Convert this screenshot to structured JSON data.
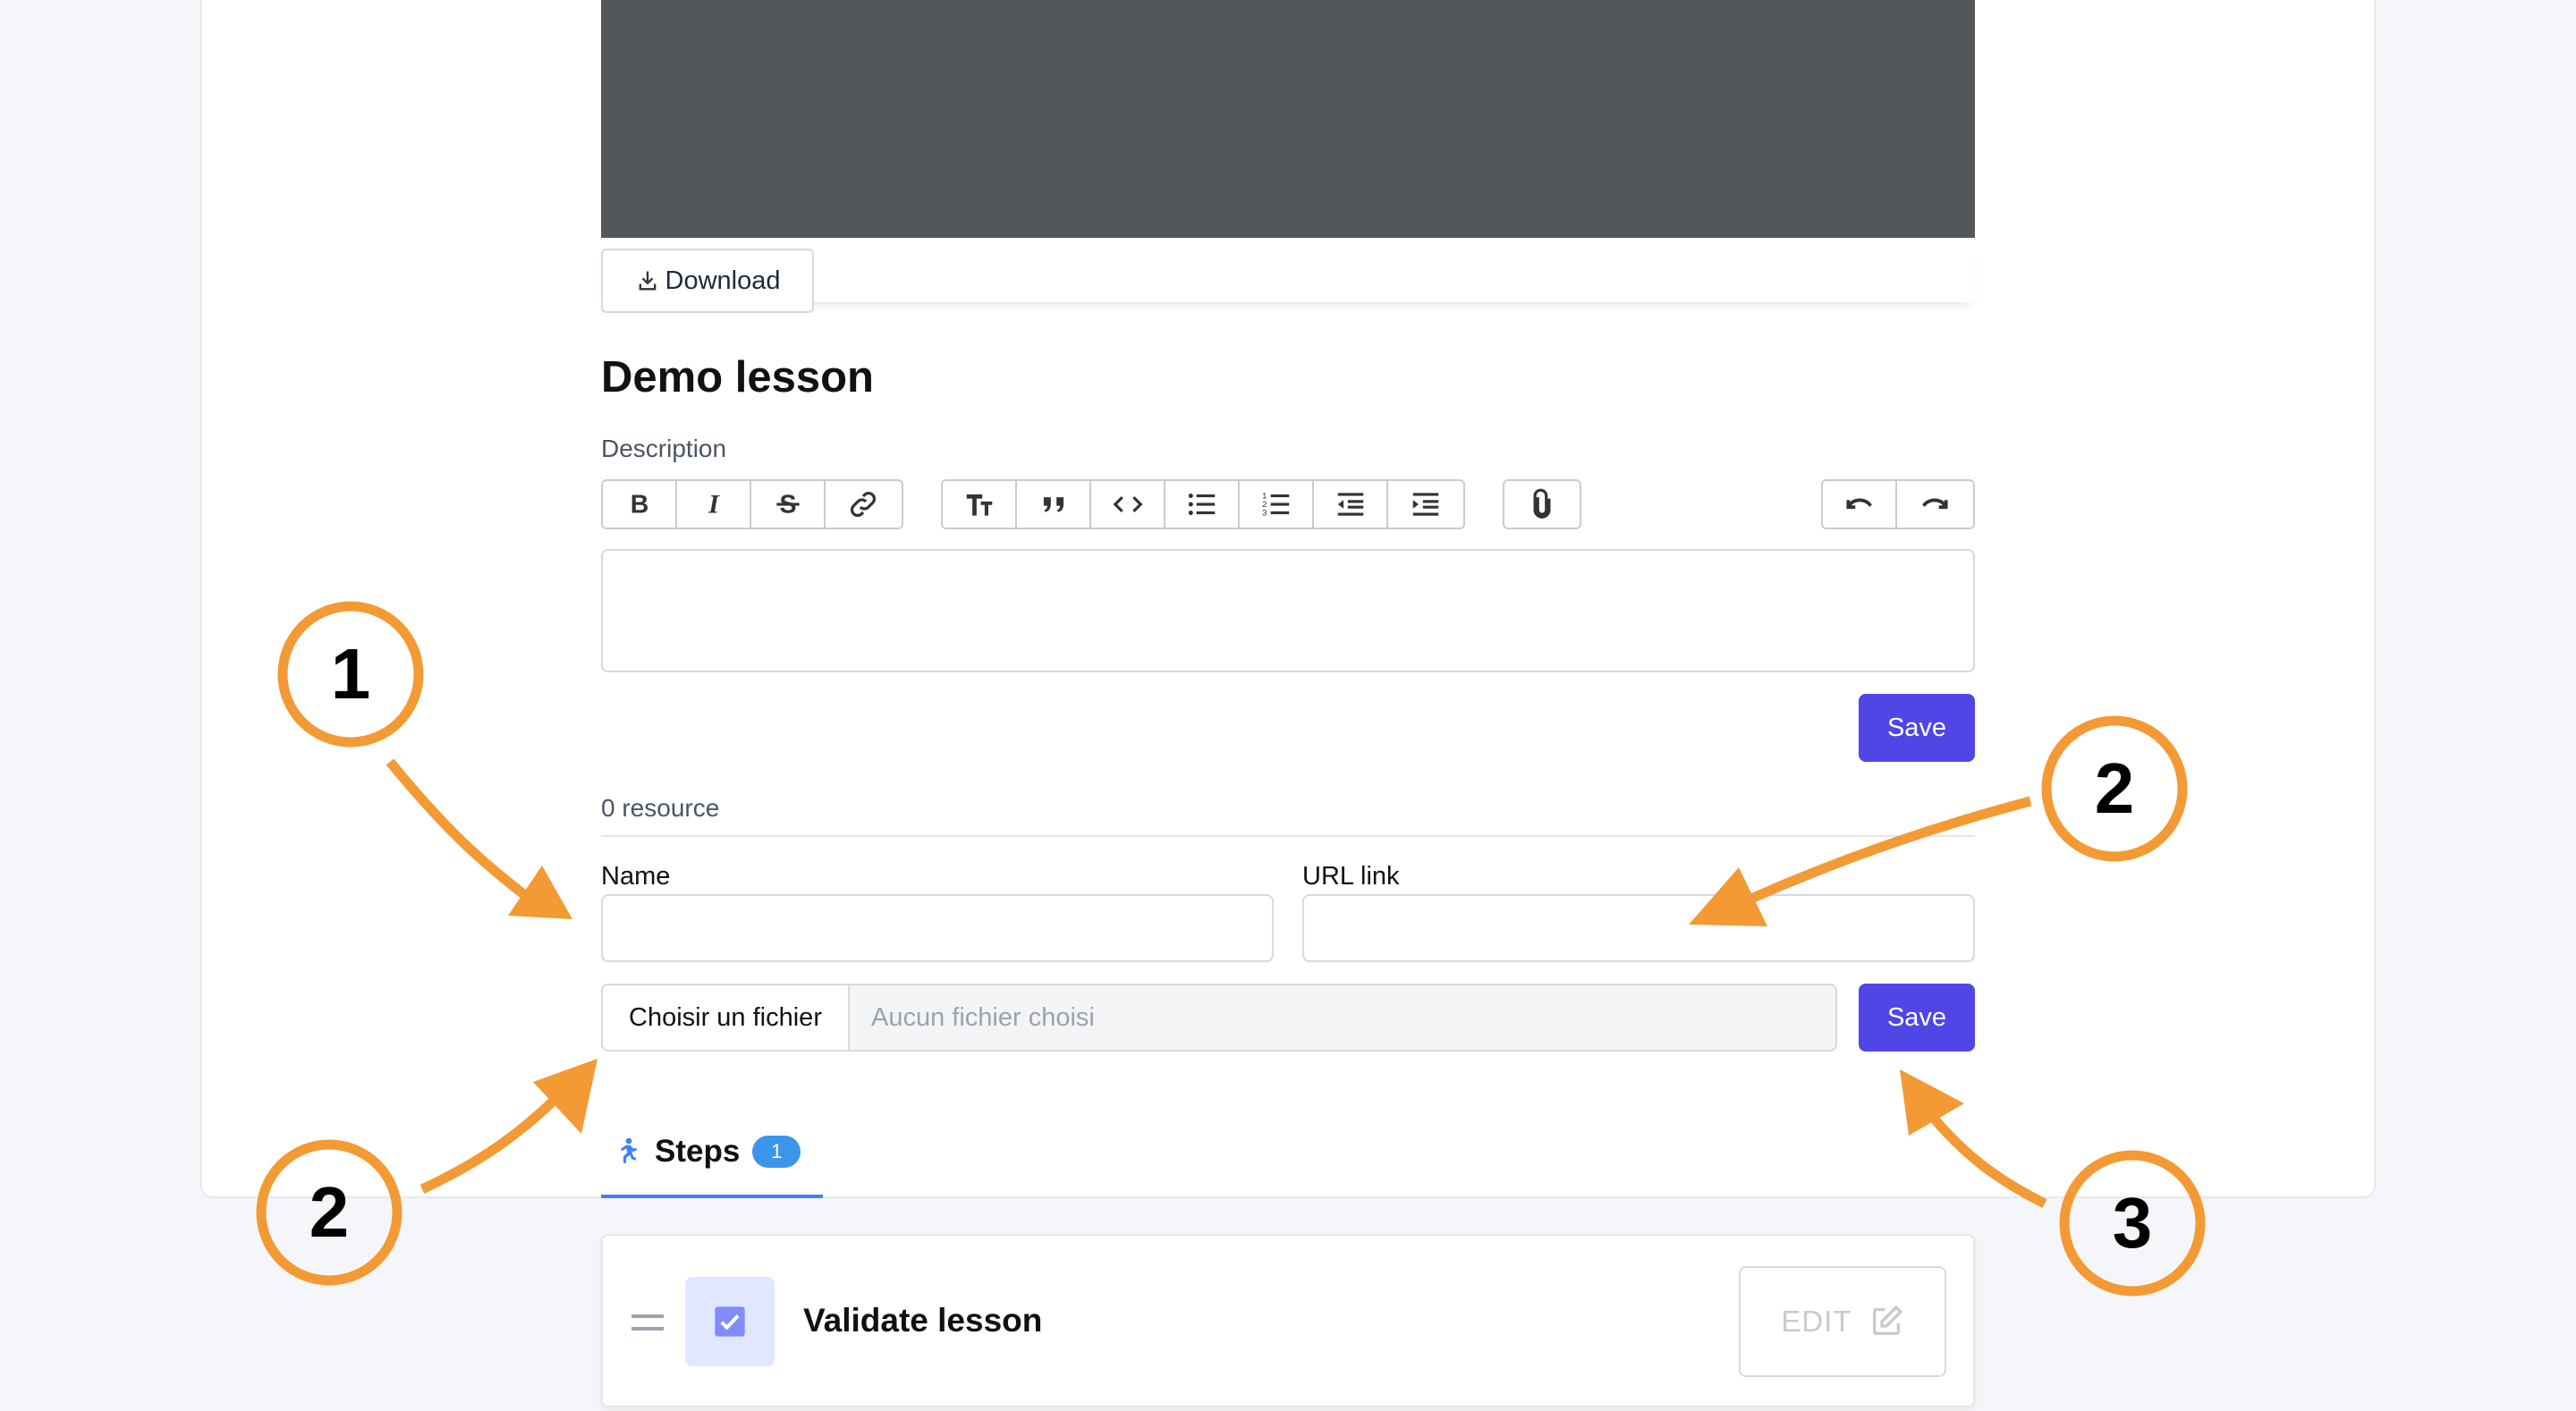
{
  "media": {
    "download_label": "Download"
  },
  "lesson": {
    "title": "Demo lesson",
    "description_label": "Description",
    "description_value": "",
    "save_label": "Save"
  },
  "toolbar": {
    "groups": [
      [
        "bold-icon",
        "italic-icon",
        "strikethrough-icon",
        "link-icon"
      ],
      [
        "heading-icon",
        "quote-icon",
        "code-icon",
        "bullet-list-icon",
        "numbered-list-icon",
        "outdent-icon",
        "indent-icon"
      ],
      [
        "attach-icon"
      ],
      [
        "undo-icon",
        "redo-icon"
      ]
    ]
  },
  "resources": {
    "count_label": "0 resource",
    "name_label": "Name",
    "name_value": "",
    "url_label": "URL link",
    "url_value": "",
    "file_button_label": "Choisir un fichier",
    "file_status": "Aucun fichier choisi",
    "save_label": "Save"
  },
  "steps": {
    "tab_label": "Steps",
    "count": "1",
    "items": [
      {
        "title": "Validate lesson",
        "edit_label": "EDIT"
      }
    ]
  },
  "annotations": {
    "callouts": [
      "1",
      "2",
      "2",
      "3"
    ],
    "color": "#f39a34"
  },
  "colors": {
    "primary": "#4f46e5",
    "tab_accent": "#3b82f6",
    "annotation": "#f39a34"
  }
}
